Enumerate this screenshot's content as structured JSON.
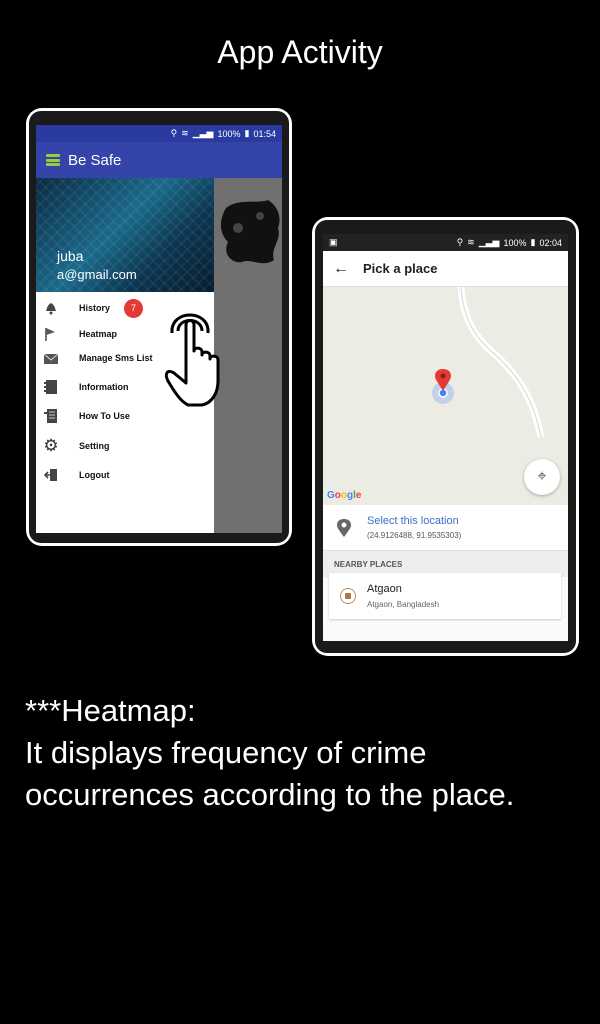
{
  "page": {
    "title": "App Activity",
    "caption_heading": "***Heatmap:",
    "caption_body": "It displays frequency of crime occurrences according to the place."
  },
  "left_phone": {
    "status_time": "01:54",
    "status_battery": "100%",
    "app_title": "Be Safe",
    "user": {
      "name": "juba",
      "email": "a@gmail.com"
    },
    "menu": [
      {
        "label": "History",
        "icon": "bell-icon",
        "badge": "7"
      },
      {
        "label": "Heatmap",
        "icon": "flag-icon"
      },
      {
        "label": "Manage Sms List",
        "icon": "mail-icon"
      },
      {
        "label": "Information",
        "icon": "info-book-icon"
      },
      {
        "label": "How To Use",
        "icon": "manual-icon"
      },
      {
        "label": "Setting",
        "icon": "gear-icon"
      },
      {
        "label": "Logout",
        "icon": "logout-icon"
      }
    ],
    "accent_color": "#3444a8",
    "badge_color": "#e53935"
  },
  "right_phone": {
    "status_time": "02:04",
    "status_battery": "100%",
    "header_title": "Pick a place",
    "map_logo": "Google",
    "select_location_label": "Select this location",
    "select_location_coords": "(24.9126488, 91.9535303)",
    "nearby_heading": "NEARBY PLACES",
    "nearby": [
      {
        "name": "Atgaon",
        "address": "Atgaon, Bangladesh"
      }
    ],
    "link_color": "#3a6fc4",
    "marker_color": "#e53935"
  }
}
